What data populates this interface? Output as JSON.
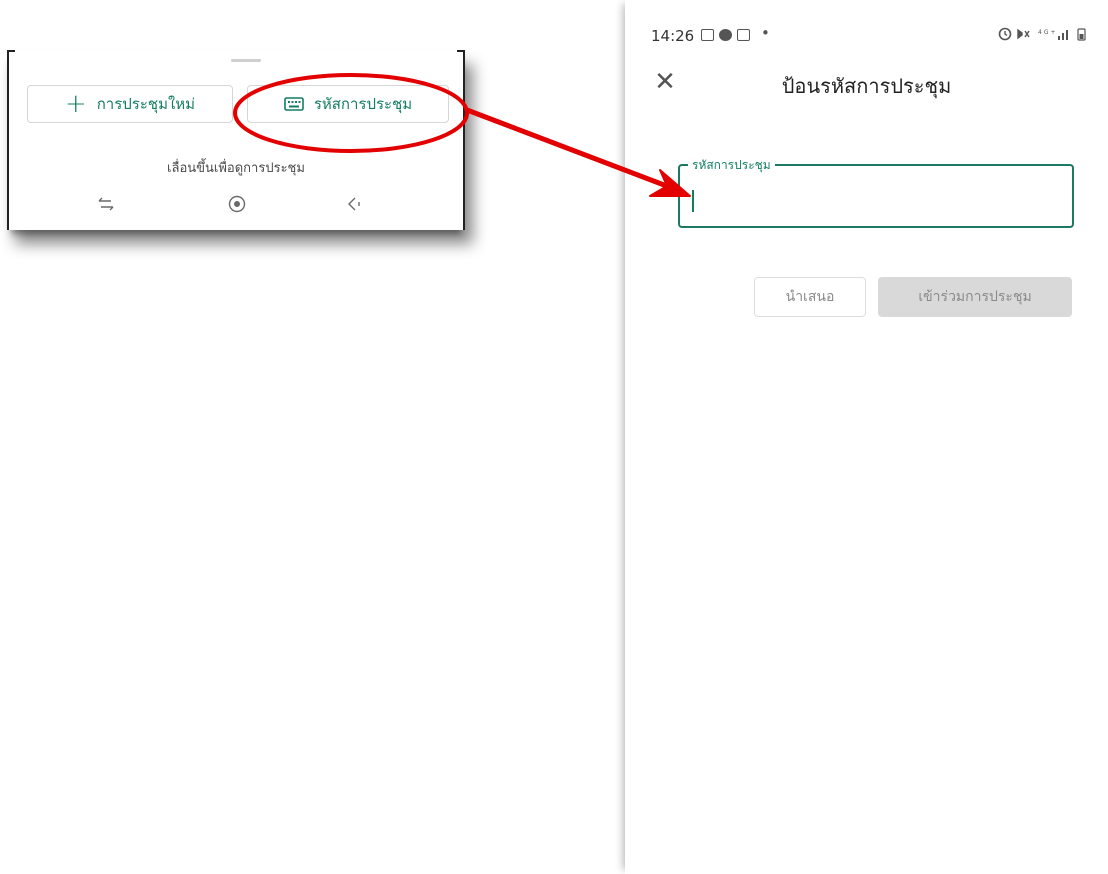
{
  "inset": {
    "new_meeting_label": "การประชุมใหม่",
    "new_meeting_icon": "plus-icon",
    "meeting_code_label": "รหัสการประชุม",
    "meeting_code_icon": "keyboard-icon",
    "swipe_hint": "เลื่อนขึ้นเพื่อดูการประชุม",
    "nav": [
      "recent-apps-icon",
      "home-icon",
      "back-icon"
    ]
  },
  "annotation": {
    "color": "#e30000"
  },
  "phone": {
    "status": {
      "time": "14:26",
      "right_indicators": "alarm, mute, 4G, signal, battery"
    },
    "title": "ป้อนรหัสการประชุม",
    "close_icon": "close-icon",
    "code_field": {
      "label": "รหัสการประชุม",
      "value": ""
    },
    "buttons": {
      "present_label": "นำเสนอ",
      "join_label": "เข้าร่วมการประชุม"
    },
    "accent_color": "#137d62"
  }
}
